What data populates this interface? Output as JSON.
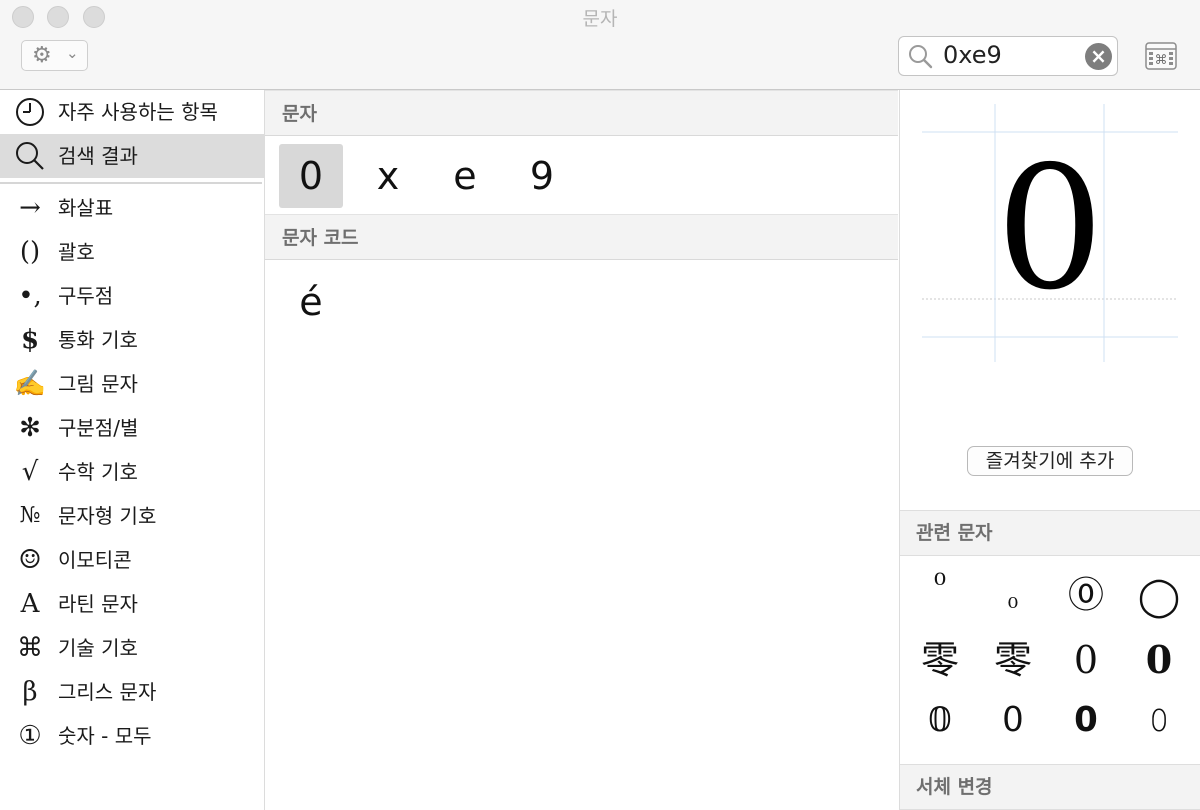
{
  "window": {
    "title": "문자"
  },
  "search": {
    "value": "0xe9"
  },
  "sidebar": {
    "items": [
      {
        "icon": "clock-icon",
        "glyph": "◷",
        "label": "자주 사용하는 항목"
      },
      {
        "icon": "magnifier-icon",
        "glyph": "⚲",
        "label": "검색 결과"
      },
      {
        "icon": "arrow-icon",
        "glyph": "→",
        "label": "화살표"
      },
      {
        "icon": "parentheses-icon",
        "glyph": "()",
        "label": "괄호"
      },
      {
        "icon": "punctuation-icon",
        "glyph": "•,",
        "label": "구두점"
      },
      {
        "icon": "dollar-icon",
        "glyph": "$",
        "label": "통화 기호"
      },
      {
        "icon": "pictograph-icon",
        "glyph": "✍",
        "label": "그림 문자"
      },
      {
        "icon": "asterisk-icon",
        "glyph": "✻",
        "label": "구분점/별"
      },
      {
        "icon": "sqrt-icon",
        "glyph": "√",
        "label": "수학 기호"
      },
      {
        "icon": "numero-icon",
        "glyph": "№",
        "label": "문자형 기호"
      },
      {
        "icon": "smiley-icon",
        "glyph": "☺",
        "label": "이모티콘"
      },
      {
        "icon": "latin-a-icon",
        "glyph": "A",
        "label": "라틴 문자"
      },
      {
        "icon": "command-icon",
        "glyph": "⌘",
        "label": "기술 기호"
      },
      {
        "icon": "beta-icon",
        "glyph": "β",
        "label": "그리스 문자"
      },
      {
        "icon": "circled-one-icon",
        "glyph": "①",
        "label": "숫자 - 모두"
      }
    ]
  },
  "center": {
    "characters_header": "문자",
    "characters": [
      "0",
      "x",
      "e",
      "9"
    ],
    "codes_header": "문자 코드",
    "codes": [
      "é"
    ]
  },
  "preview": {
    "glyph": "0",
    "favorite_button": "즐겨찾기에 추가",
    "related_header": "관련 문자",
    "related": [
      "⁰",
      "₀",
      "⓪",
      "◯",
      "零",
      "零",
      "0",
      "𝟎",
      "𝟘",
      "𝟢",
      "𝟬",
      "𝟶"
    ],
    "font_variation_header": "서체 변경"
  },
  "colors": {
    "selection": "#d8d8d8",
    "header_bg": "#f3f3f3",
    "header_text": "#6f6f6f"
  }
}
